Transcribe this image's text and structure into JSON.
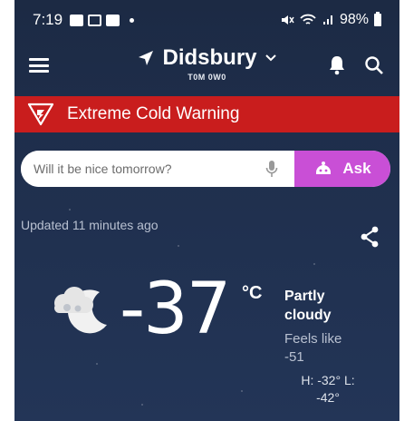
{
  "status_bar": {
    "time": "7:19",
    "battery": "98%"
  },
  "header": {
    "location_name": "Didsbury",
    "postal_code": "T0M 0W0"
  },
  "alert": {
    "text": "Extreme Cold Warning",
    "color": "#c91d1d"
  },
  "ask": {
    "placeholder": "Will it be nice tomorrow?",
    "button_label": "Ask",
    "button_color": "#c94fd6"
  },
  "updated_text": "Updated 11 minutes ago",
  "current": {
    "icon": "partly-cloudy-night-icon",
    "temperature": "-37",
    "unit": "°C",
    "condition_line1": "Partly",
    "condition_line2": "cloudy",
    "feels_like_label": "Feels like",
    "feels_like_value": "-51",
    "hilo_line1": "H: -32° L:",
    "hilo_line2": "-42°"
  }
}
